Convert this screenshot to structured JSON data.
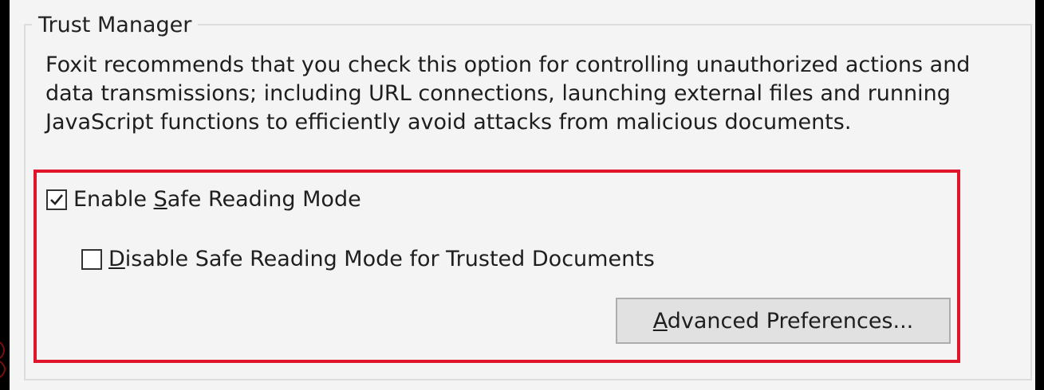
{
  "group": {
    "title": "Trust Manager",
    "description_lines": [
      "Foxit recommends that you check this option for controlling unauthorized actions and",
      "data transmissions; including URL connections, launching external files and running",
      "JavaScript functions to efficiently avoid attacks from malicious documents."
    ]
  },
  "options": {
    "enable_safe_reading": {
      "label": "Enable Safe Reading Mode",
      "mnemonic": "S",
      "checked": true
    },
    "disable_for_trusted": {
      "label": "Disable Safe Reading Mode for Trusted Documents",
      "mnemonic": "D",
      "checked": false
    }
  },
  "buttons": {
    "advanced_preferences": "Advanced Preferences..."
  },
  "colors": {
    "highlight": "#e0142b",
    "panel": "#f4f4f4",
    "button_face": "#e1e1e1"
  }
}
